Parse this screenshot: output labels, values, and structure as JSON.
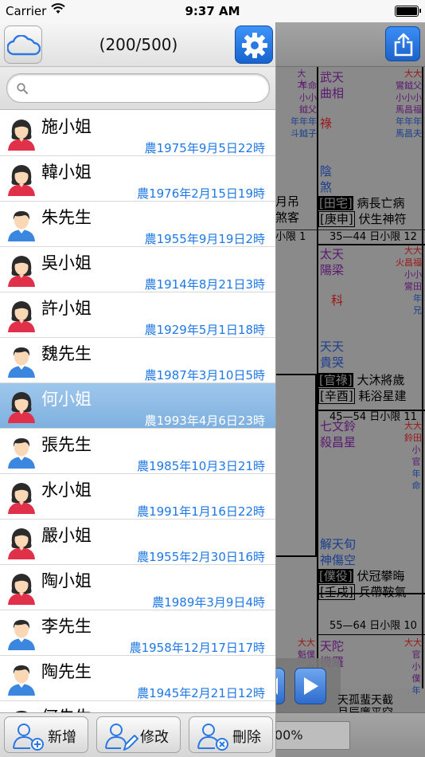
{
  "status_bar": {
    "carrier": "Carrier",
    "time": "9:37 AM"
  },
  "header": {
    "count": "(200/500)"
  },
  "search": {
    "placeholder": "",
    "value": ""
  },
  "colors": {
    "accent": "#1e78e6",
    "selected_row": "#8dbbe6",
    "button_blue": "#2a78e4"
  },
  "list": [
    {
      "name": "施小姐",
      "date": "農1975年9月5日22時",
      "gender": "female"
    },
    {
      "name": "韓小姐",
      "date": "農1976年2月15日19時",
      "gender": "female"
    },
    {
      "name": "朱先生",
      "date": "農1955年9月19日2時",
      "gender": "male"
    },
    {
      "name": "吳小姐",
      "date": "農1914年8月21日3時",
      "gender": "female"
    },
    {
      "name": "許小姐",
      "date": "農1929年5月1日18時",
      "gender": "female"
    },
    {
      "name": "魏先生",
      "date": "農1987年3月10日5時",
      "gender": "male"
    },
    {
      "name": "何小姐",
      "date": "農1993年4月6日23時",
      "gender": "female",
      "selected": true
    },
    {
      "name": "張先生",
      "date": "農1985年10月3日21時",
      "gender": "male"
    },
    {
      "name": "水小姐",
      "date": "農1991年1月16日22時",
      "gender": "female"
    },
    {
      "name": "嚴小姐",
      "date": "農1955年2月30日16時",
      "gender": "female"
    },
    {
      "name": "陶小姐",
      "date": "農1989年3月9日4時",
      "gender": "female"
    },
    {
      "name": "李先生",
      "date": "農1958年12月17日17時",
      "gender": "male"
    },
    {
      "name": "陶先生",
      "date": "農1945年2月21日12時",
      "gender": "male"
    },
    {
      "name": "何先生",
      "date": "",
      "gender": "male"
    }
  ],
  "toolbar": {
    "add_label": "新增",
    "edit_label": "修改",
    "delete_label": "刪除"
  },
  "background_chart": {
    "cells": [
      {
        "stars_main": "武天",
        "stars_main2": "曲相",
        "hua": "祿",
        "minor": "陰",
        "minor2": "煞",
        "palace": "[田宅]",
        "palace_extra": "病長亡病",
        "stem": "[庚申]",
        "stem_extra": "伏生神符",
        "range": "35—44 日小限 12"
      },
      {
        "stars_main": "太天",
        "stars_main2": "陽梁",
        "hua": "科",
        "minor": "天天",
        "minor2": "貴哭",
        "palace": "[官祿]",
        "palace_extra": "大沐將歲",
        "stem": "[辛酉]",
        "stem_extra": "耗浴星建",
        "range": "45—54 日小限 11"
      },
      {
        "stars_main": "七文鈴",
        "stars_main2": "殺昌星",
        "hua": "",
        "minor": "解天旬",
        "minor2": "神傷空",
        "palace": "[僕役]",
        "palace_extra": "伏冠攀晦",
        "stem": "[壬戌]",
        "stem_extra": "兵帶鞍氣",
        "range": "55—64 日小限 10"
      },
      {
        "stars_main": "天陀",
        "stars_main2": "機羅",
        "hua": "",
        "minor": "",
        "minor2": "",
        "palace": "",
        "palace_extra": "",
        "stem": "",
        "stem_extra": "",
        "range": ""
      }
    ],
    "left_fragments": [
      "月吊",
      "煞客",
      "小限 1"
    ],
    "cell1_small": [
      "大大",
      "鸞鉞父",
      "小小小",
      "馬昌福",
      "年年年",
      "馬昌夫"
    ],
    "cell1_left_small": [
      "大大",
      "羊命",
      "小小",
      "鉞父",
      "年年年",
      "斗鉞子"
    ],
    "cell2_small": [
      "大大",
      "火昌福",
      "小小",
      "鸞田",
      "年",
      "兄"
    ],
    "cell3_small": [
      "大大",
      "鈴田",
      "小",
      "官",
      "年",
      "命"
    ],
    "cell4_small": [
      "大大",
      "官",
      "小",
      "僕",
      "年",
      "父"
    ],
    "cell4_left_small": [
      "大大",
      "魁僕",
      "小",
      "遷",
      "年",
      "福"
    ],
    "bottom_fragment": "天孤蜚天截",
    "bottom_fragment2": "月辰廉平空",
    "cell4_partial": "巨",
    "zoom": "00%"
  }
}
